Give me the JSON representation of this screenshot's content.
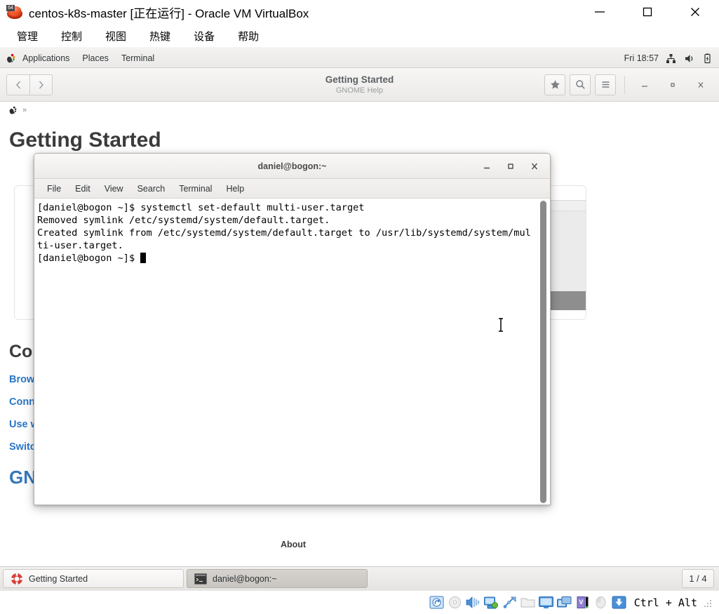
{
  "vbox": {
    "title": "centos-k8s-master [正在运行] - Oracle VM VirtualBox",
    "icon": "virtualbox-icon",
    "icon_badge": "64",
    "menus": [
      "管理",
      "控制",
      "视图",
      "热键",
      "设备",
      "帮助"
    ],
    "window_controls": {
      "minimize": "minimize-icon",
      "maximize": "maximize-icon",
      "close": "close-icon"
    },
    "statusbar": {
      "icons": [
        "hard-disk-icon",
        "optical-drive-icon",
        "audio-icon",
        "network-icon",
        "usb-icon",
        "shared-folders-icon",
        "display-icon",
        "remote-desktop-icon",
        "video-capture-icon",
        "mouse-icon",
        "host-key-icon"
      ],
      "host_key": "Ctrl + Alt"
    }
  },
  "gnome_panel": {
    "activities_icon": "gnome-foot-icon",
    "items": [
      "Applications",
      "Places",
      "Terminal"
    ],
    "clock": "Fri 18:57",
    "tray_icons": [
      "network-icon",
      "volume-icon",
      "battery-icon"
    ]
  },
  "help_window": {
    "title": "Getting Started",
    "subtitle": "GNOME Help",
    "nav": {
      "back": "chevron-left-icon",
      "forward": "chevron-right-icon"
    },
    "header_buttons": [
      {
        "name": "bookmark-button",
        "icon": "star-icon"
      },
      {
        "name": "search-button",
        "icon": "search-icon"
      },
      {
        "name": "menu-button",
        "icon": "hamburger-icon"
      }
    ],
    "window_controls": {
      "minimize": "minimize-icon",
      "maximize": "maximize-icon",
      "close": "close-icon"
    },
    "breadcrumb": {
      "icon": "gnome-foot-icon",
      "chevron": "»"
    },
    "content": {
      "heading": "Getting Started",
      "figure_alt": "gnome-desktop-screenshot",
      "section_heading": "Common Tasks",
      "links": [
        "Browse the web",
        "Connect to a network",
        "Use windows and workspaces",
        "Switch tasks"
      ],
      "footer_link": "GNOME Help",
      "about": "About"
    }
  },
  "terminal": {
    "title": "daniel@bogon:~",
    "menus": [
      "File",
      "Edit",
      "View",
      "Search",
      "Terminal",
      "Help"
    ],
    "window_controls": {
      "minimize": "minimize-icon",
      "maximize": "maximize-icon",
      "close": "close-icon"
    },
    "output": "[daniel@bogon ~]$ systemctl set-default multi-user.target\nRemoved symlink /etc/systemd/system/default.target.\nCreated symlink from /etc/systemd/system/default.target to /usr/lib/systemd/system/multi-user.target.\n[daniel@bogon ~]$ ",
    "cursor": "block-cursor",
    "mouse_pointer": "i-beam-cursor"
  },
  "taskbar": {
    "items": [
      {
        "label": "Getting Started",
        "icon": "help-icon",
        "active": false
      },
      {
        "label": "daniel@bogon:~",
        "icon": "terminal-icon",
        "active": true
      }
    ],
    "workspace": "1 / 4"
  },
  "colors": {
    "link_blue": "#2a76c6",
    "heading_gray": "#3b3b3b",
    "panel_bg": "#f2f1f0",
    "terminal_bg": "#ffffff"
  }
}
